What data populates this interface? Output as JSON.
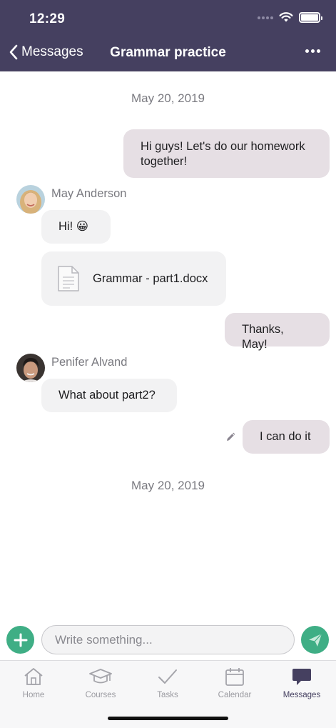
{
  "status_bar": {
    "time": "12:29"
  },
  "nav": {
    "back_label": "Messages",
    "title": "Grammar practice"
  },
  "dates": [
    "May 20, 2019",
    "May 20, 2019"
  ],
  "messages": [
    {
      "kind": "outgoing",
      "text": "Hi guys! Let's do our homework together!"
    },
    {
      "kind": "incoming",
      "sender": "May Anderson",
      "text": "Hi! 😀"
    },
    {
      "kind": "incoming-file",
      "file_name": "Grammar - part1.docx"
    },
    {
      "kind": "outgoing",
      "text": "Thanks, May!"
    },
    {
      "kind": "incoming",
      "sender": "Penifer Alvand",
      "text": "What about part2?"
    },
    {
      "kind": "outgoing",
      "text": "I can do it"
    }
  ],
  "composer": {
    "placeholder": "Write something..."
  },
  "tabs": [
    {
      "label": "Home",
      "icon": "home-icon"
    },
    {
      "label": "Courses",
      "icon": "graduation-cap-icon"
    },
    {
      "label": "Tasks",
      "icon": "checkmark-icon"
    },
    {
      "label": "Calendar",
      "icon": "calendar-icon"
    },
    {
      "label": "Messages",
      "icon": "chat-bubble-icon",
      "active": true
    }
  ],
  "colors": {
    "header": "#454060",
    "accent_green": "#3fae85",
    "outgoing_bubble": "#e6dfe4",
    "incoming_bubble": "#f2f2f3"
  }
}
